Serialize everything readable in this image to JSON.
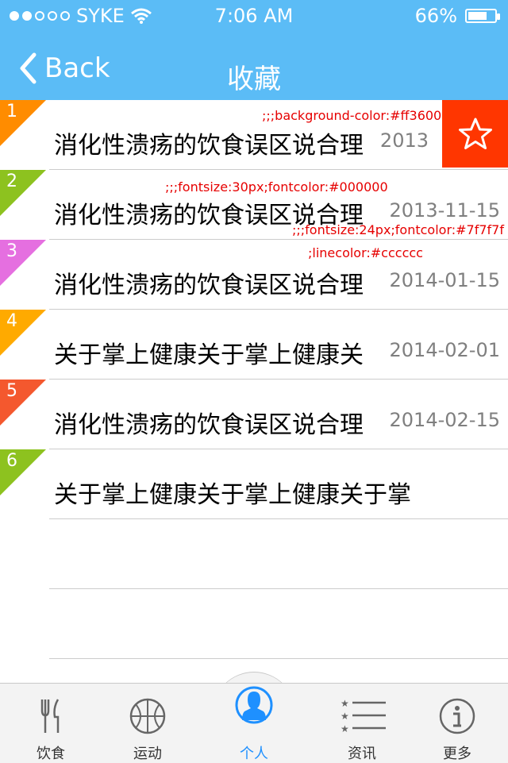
{
  "status_bar": {
    "carrier": "SYKE",
    "time": "7:06 AM",
    "battery": "66%",
    "battery_level": 0.66
  },
  "nav": {
    "back_label": "Back",
    "title": "收藏"
  },
  "items": [
    {
      "num": "1",
      "text": "消化性溃疡的饮食误区说合理",
      "date": "2013",
      "color": "#ff8c00"
    },
    {
      "num": "2",
      "text": "消化性溃疡的饮食误区说合理",
      "date": "2013-11-15",
      "color": "#8dc21f"
    },
    {
      "num": "3",
      "text": "消化性溃疡的饮食误区说合理",
      "date": "2014-01-15",
      "color": "#e56fe0"
    },
    {
      "num": "4",
      "text": "关于掌上健康关于掌上健康关",
      "date": "2014-02-01",
      "color": "#ffaa00"
    },
    {
      "num": "5",
      "text": "消化性溃疡的饮食误区说合理",
      "date": "2014-02-15",
      "color": "#f4582e"
    },
    {
      "num": "6",
      "text": "关于掌上健康关于掌上健康关于掌",
      "date": "",
      "color": "#8dc21f"
    }
  ],
  "star_button": {
    "icon": "star-icon",
    "color": "#ff3600"
  },
  "annotations": {
    "a1": ";;;background-color:#ff3600",
    "a2": ";;;fontsize:30px;fontcolor:#000000",
    "a3": ";;;fontsize:24px;fontcolor:#7f7f7f",
    "a4": ";linecolor:#cccccc"
  },
  "tabs": [
    {
      "label": "饮食",
      "icon": "fork-knife-icon"
    },
    {
      "label": "运动",
      "icon": "ball-icon"
    },
    {
      "label": "个人",
      "icon": "person-icon",
      "active": true
    },
    {
      "label": "资讯",
      "icon": "list-icon"
    },
    {
      "label": "更多",
      "icon": "info-icon"
    }
  ]
}
